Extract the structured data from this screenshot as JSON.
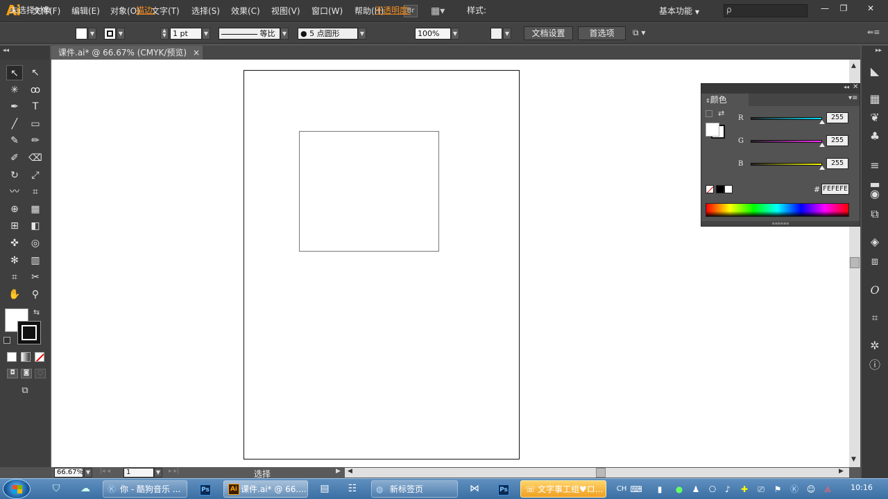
{
  "app": {
    "logo": "Ai"
  },
  "menubar": {
    "items": [
      "文件(F)",
      "编辑(E)",
      "对象(O)",
      "文字(T)",
      "选择(S)",
      "效果(C)",
      "视图(V)",
      "窗口(W)",
      "帮助(H)"
    ],
    "bridge_label": "Br",
    "workspace": "基本功能",
    "search_placeholder": "ρ",
    "minimize": "—",
    "restore": "❐",
    "close": "✕"
  },
  "controlbar": {
    "selection_status": "未选择对象",
    "stroke_label": "描边:",
    "stroke_weight": "1 pt",
    "stroke_profile": "等比",
    "brush": "● 5 点圆形",
    "opacity_label": "不透明度:",
    "opacity": "100%",
    "style_label": "样式:",
    "doc_setup": "文档设置",
    "preferences": "首选项"
  },
  "document": {
    "tab_title": "课件.ai* @ 66.67% (CMYK/预览)",
    "tab_close": "×"
  },
  "statusbar": {
    "zoom": "66.67%",
    "artboard_number": "1",
    "mode": "选择"
  },
  "color_panel": {
    "title": "颜色",
    "channels": [
      {
        "label": "R",
        "value": "255",
        "color": "#00e5ff"
      },
      {
        "label": "G",
        "value": "255",
        "color": "#ff2bff"
      },
      {
        "label": "B",
        "value": "255",
        "color": "#ffff00"
      }
    ],
    "hex_label": "#",
    "hex": "FEFEFE"
  },
  "taskbar": {
    "items": [
      {
        "label": "你 - 酷狗音乐 ..."
      },
      {
        "label": "课件.ai* @ 66...."
      },
      {
        "label": "新标签页"
      },
      {
        "label": "文字事工组♥ロ..."
      }
    ],
    "ps_label": "Ps",
    "lang": "CH",
    "time": "10:16"
  },
  "icons": {
    "selection": "↖",
    "direct": "↖",
    "magic": "✳",
    "lasso": "ꝏ",
    "pen": "✒",
    "type": "T",
    "line": "╱",
    "rect": "▭",
    "brush": "✎",
    "pencil": "✏",
    "blob": "✐",
    "eraser": "⌫",
    "rotate": "↻",
    "scale": "⤢",
    "warp": "〰",
    "free": "⌗",
    "shapebuilder": "⊕",
    "perspective": "▦",
    "mesh": "⊞",
    "gradient": "◧",
    "eyedropper": "✜",
    "blend": "◎",
    "symbol": "✻",
    "graph": "▥",
    "artboard": "⌗",
    "slice": "✂",
    "hand": "✋",
    "zoom": "⚲"
  }
}
